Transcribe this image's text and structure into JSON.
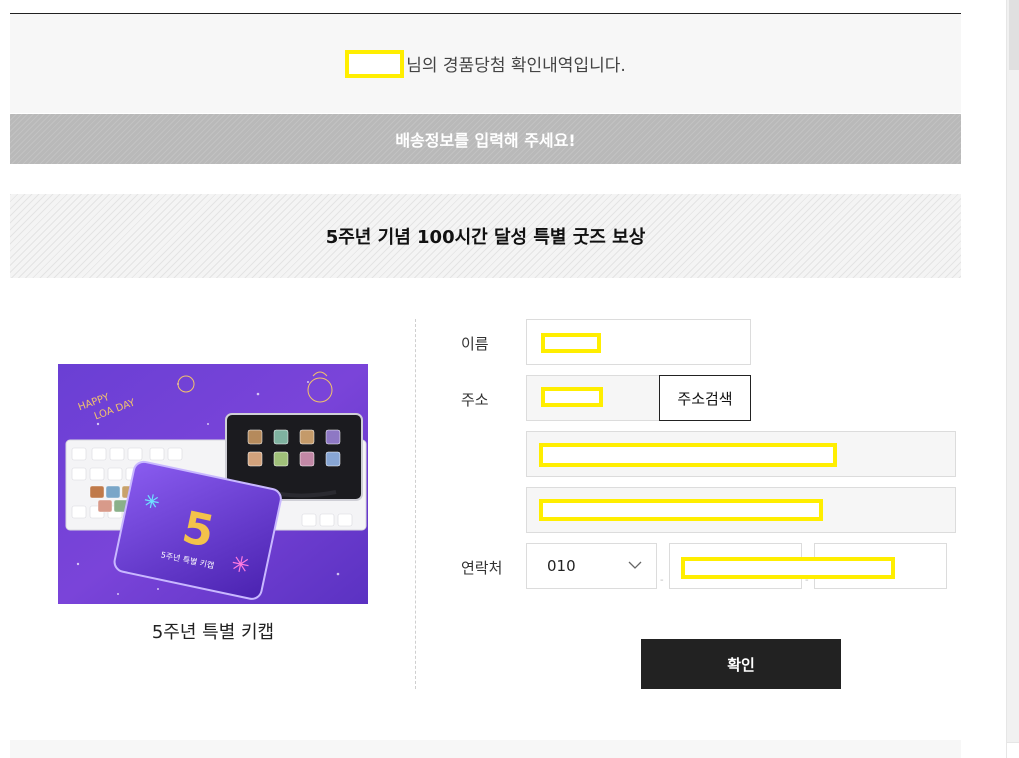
{
  "winner_banner": {
    "suffix_text": "님의 경품당첨 확인내역입니다."
  },
  "delivery_bar": {
    "text": "배송정보를 입력해 주세요!"
  },
  "reward": {
    "title": "5주년 기념 100시간 달성 특별 굿즈 보상"
  },
  "product": {
    "name": "5주년 특별 키캡",
    "image_icon": "keycap-product-image",
    "image_text": {
      "happy": "HAPPY",
      "loa_day": "LOA DAY",
      "box_label": "5주년 특별 키캡",
      "number": "5"
    }
  },
  "form": {
    "name_label": "이름",
    "address_label": "주소",
    "address_search_button": "주소검색",
    "phone_label": "연락처",
    "phone_prefix": "010",
    "phone_dash": "-",
    "confirm_button": "확인"
  },
  "colors": {
    "redaction": "#ffee00",
    "confirm_button_bg": "#222222",
    "delivery_bar_bg": "#b9b9b9"
  }
}
